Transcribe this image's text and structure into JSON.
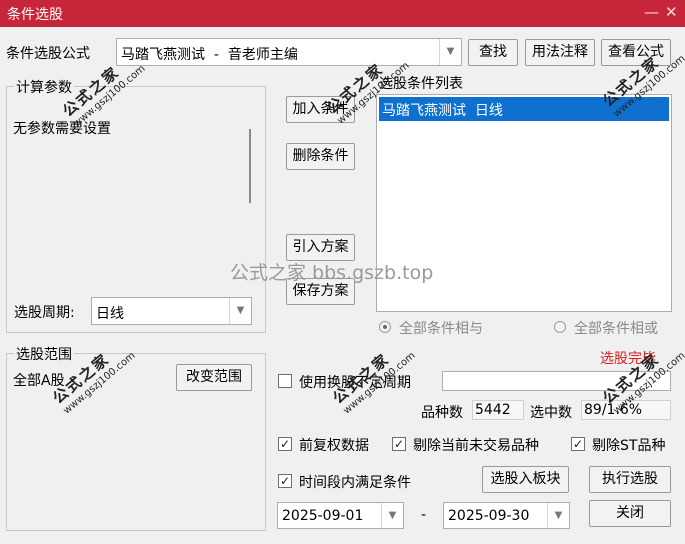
{
  "window": {
    "title": "条件选股",
    "minimize_glyph": "—",
    "close_glyph": "✕"
  },
  "formula": {
    "label": "条件选股公式",
    "value": "马踏飞燕测试  -  音老师主编",
    "find_button": "查找",
    "usage_button": "用法注释",
    "view_button": "查看公式"
  },
  "params": {
    "legend": "计算参数",
    "message": "无参数需要设置",
    "period_label": "选股周期:",
    "period_value": "日线"
  },
  "actions": {
    "add": "加入条件",
    "delete": "删除条件",
    "import": "引入方案",
    "save": "保存方案"
  },
  "conditions": {
    "legend": "选股条件列表",
    "items": [
      "马踏飞燕测试  日线"
    ],
    "and_label": "全部条件相与",
    "or_label": "全部条件相或",
    "and_selected": true
  },
  "scope": {
    "legend": "选股范围",
    "value": "全部A股",
    "change_button": "改变范围"
  },
  "status": {
    "text": "选股完毕",
    "color": "#e0201f"
  },
  "options": {
    "use_variable_period": "使用换股不定周期",
    "count_label": "品种数",
    "count_value": "5442",
    "selected_label": "选中数",
    "selected_value": "89/1.6%",
    "pre_adjust": "前复权数据",
    "exclude_untraded": "剔除当前未交易品种",
    "exclude_st": "剔除ST品种",
    "time_range": "时间段内满足条件",
    "pre_adjust_checked": true,
    "exclude_untraded_checked": true,
    "exclude_st_checked": true,
    "time_range_checked": true,
    "use_variable_checked": false
  },
  "dates": {
    "start": "2025-09-01",
    "separator": "-",
    "end": "2025-09-30"
  },
  "bottom": {
    "to_block": "选股入板块",
    "execute": "执行选股",
    "close": "关闭"
  },
  "watermark": {
    "center": "公式之家 bbs.gszb.top",
    "stamp_title": "公式之家",
    "stamp_url": "www.gszj100.com"
  },
  "check_glyph": "✓",
  "arrow_glyph": "▼"
}
